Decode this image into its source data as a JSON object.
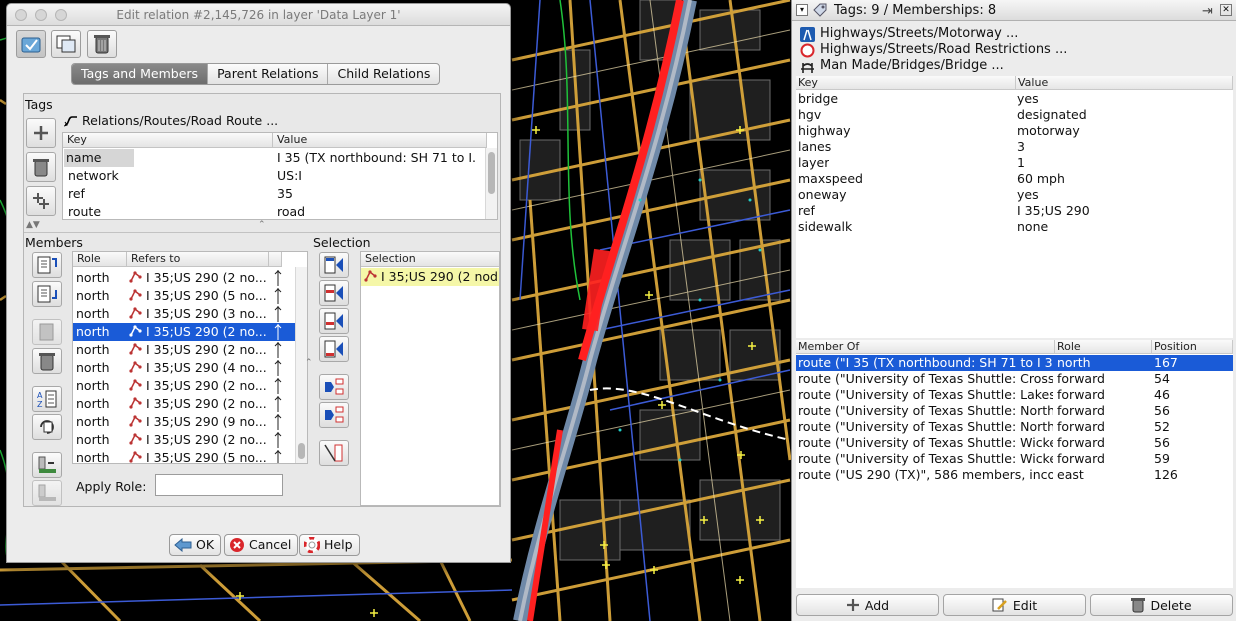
{
  "dialog": {
    "title": "Edit relation #2,145,726 in layer 'Data Layer 1'",
    "tabs": [
      "Tags and Members",
      "Parent Relations",
      "Child Relations"
    ],
    "tags_label": "Tags",
    "preset": "Relations/Routes/Road Route ...",
    "tag_columns": [
      "Key",
      "Value"
    ],
    "tags": [
      {
        "key": "name",
        "value": "I 35 (TX northbound: SH 71 to I..."
      },
      {
        "key": "network",
        "value": "US:I"
      },
      {
        "key": "ref",
        "value": "35"
      },
      {
        "key": "route",
        "value": "road"
      }
    ],
    "members_label": "Members",
    "member_columns": [
      "Role",
      "Refers to"
    ],
    "members": [
      {
        "role": "north",
        "ref": "I 35;US 290 (2 no..."
      },
      {
        "role": "north",
        "ref": "I 35;US 290 (5 no..."
      },
      {
        "role": "north",
        "ref": "I 35;US 290 (3 no..."
      },
      {
        "role": "north",
        "ref": "I 35;US 290 (2 no..."
      },
      {
        "role": "north",
        "ref": "I 35;US 290 (2 no..."
      },
      {
        "role": "north",
        "ref": "I 35;US 290 (4 no..."
      },
      {
        "role": "north",
        "ref": "I 35;US 290 (2 no..."
      },
      {
        "role": "north",
        "ref": "I 35;US 290 (2 no..."
      },
      {
        "role": "north",
        "ref": "I 35;US 290 (9 no..."
      },
      {
        "role": "north",
        "ref": "I 35;US 290 (2 no..."
      },
      {
        "role": "north",
        "ref": "I 35;US 290 (5 no..."
      }
    ],
    "selected_member_index": 3,
    "selection_label": "Selection",
    "selection_column": "Selection",
    "selection_item": "I 35;US 290 (2 nod",
    "apply_role_label": "Apply Role:",
    "apply_role_value": "",
    "buttons": {
      "ok": "OK",
      "cancel": "Cancel",
      "help": "Help"
    }
  },
  "right_panel": {
    "title": "Tags: 9 / Memberships: 8",
    "presets": [
      {
        "icon": "motorway-sign-icon",
        "label": "Highways/Streets/Motorway ..."
      },
      {
        "icon": "road-restriction-icon",
        "label": "Highways/Streets/Road Restrictions ..."
      },
      {
        "icon": "bridge-icon",
        "label": "Man Made/Bridges/Bridge ..."
      }
    ],
    "tag_columns": [
      "Key",
      "Value"
    ],
    "tags": [
      {
        "key": "bridge",
        "value": "yes"
      },
      {
        "key": "hgv",
        "value": "designated"
      },
      {
        "key": "highway",
        "value": "motorway"
      },
      {
        "key": "lanes",
        "value": "3"
      },
      {
        "key": "layer",
        "value": "1"
      },
      {
        "key": "maxspeed",
        "value": "60 mph"
      },
      {
        "key": "oneway",
        "value": "yes"
      },
      {
        "key": "ref",
        "value": "I 35;US 290"
      },
      {
        "key": "sidewalk",
        "value": "none"
      }
    ],
    "membership_columns": [
      "Member Of",
      "Role",
      "Position"
    ],
    "memberships": [
      {
        "member_of": "route (\"I 35 (TX northbound: SH 71 to I 3...",
        "role": "north",
        "position": "167"
      },
      {
        "member_of": "route (\"University of Texas Shuttle: Crossin...",
        "role": "forward",
        "position": "54"
      },
      {
        "member_of": "route (\"University of Texas Shuttle: Lakesh...",
        "role": "forward",
        "position": "46"
      },
      {
        "member_of": "route (\"University of Texas Shuttle: North ...",
        "role": "forward",
        "position": "56"
      },
      {
        "member_of": "route (\"University of Texas Shuttle: North ...",
        "role": "forward",
        "position": "52"
      },
      {
        "member_of": "route (\"University of Texas Shuttle: Wicker...",
        "role": "forward",
        "position": "56"
      },
      {
        "member_of": "route (\"University of Texas Shuttle: Wicker...",
        "role": "forward",
        "position": "59"
      },
      {
        "member_of": "route (\"US 290 (TX)\", 586 members, inco...",
        "role": "east",
        "position": "126"
      }
    ],
    "selected_membership_index": 0,
    "buttons": {
      "add": "Add",
      "edit": "Edit",
      "delete": "Delete"
    }
  },
  "colors": {
    "selection": "#1a5bd7",
    "map_background": "#000000",
    "road": "#e2b34a",
    "motorway_highlight": "#ff2020",
    "selection_row_highlight": "#f5f7a8"
  }
}
